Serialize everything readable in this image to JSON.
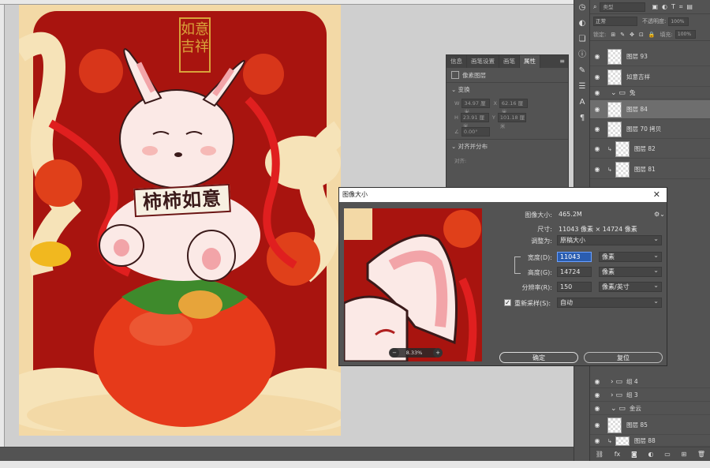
{
  "artwork": {
    "banner_text": "柿柿如意",
    "seal_text": "如意吉祥"
  },
  "properties_panel": {
    "tabs": [
      "信息",
      "画笔设置",
      "画笔",
      "属性"
    ],
    "active_tab": "属性",
    "layer_type": "像素图层",
    "section_transform": "变换",
    "w_label": "W",
    "w_value": "34.97 厘米",
    "x_label": "X",
    "x_value": "62.16 厘米",
    "h_label": "H",
    "h_value": "23.91 厘米",
    "y_label": "Y",
    "y_value": "101.18 厘米",
    "angle_value": "0.00°",
    "section_align": "对齐并分布",
    "align_label": "对齐:"
  },
  "layers_panel": {
    "search_placeholder": "类型",
    "blend_mode": "正常",
    "opacity_label": "不透明度:",
    "opacity_value": "100%",
    "lock_label": "锁定:",
    "fill_label": "填充:",
    "fill_value": "100%",
    "layers": [
      {
        "name": "图层 93",
        "kind": "layer",
        "selected": false
      },
      {
        "name": "如意吉祥",
        "kind": "layer",
        "selected": false
      },
      {
        "name": "兔",
        "kind": "group",
        "selected": false
      },
      {
        "name": "图层 84",
        "kind": "layer",
        "selected": true
      },
      {
        "name": "图层 70 拷贝",
        "kind": "layer",
        "selected": false
      },
      {
        "name": "图层 82",
        "kind": "layer",
        "selected": false
      },
      {
        "name": "图层 81",
        "kind": "layer",
        "selected": false
      },
      {
        "name": "组 4",
        "kind": "group",
        "selected": false
      },
      {
        "name": "组 3",
        "kind": "group",
        "selected": false
      },
      {
        "name": "金云",
        "kind": "group",
        "selected": false
      },
      {
        "name": "图层 85",
        "kind": "layer",
        "selected": false
      },
      {
        "name": "图层 88",
        "kind": "layer",
        "selected": false
      }
    ]
  },
  "image_size_dialog": {
    "title": "图像大小",
    "image_size_label": "图像大小:",
    "image_size_value": "465.2M",
    "dimensions_label": "尺寸:",
    "dimensions_value": "11043 像素 × 14724 像素",
    "fit_to_label": "调整为:",
    "fit_to_value": "原稿大小",
    "width_label": "宽度(D):",
    "width_value": "11043",
    "width_unit": "像素",
    "height_label": "高度(G):",
    "height_value": "14724",
    "height_unit": "像素",
    "resolution_label": "分辨率(R):",
    "resolution_value": "150",
    "resolution_unit": "像素/英寸",
    "resample_label": "重新采样(S):",
    "resample_value": "自动",
    "resample_checked": true,
    "zoom_value": "8.33%",
    "ok_label": "确定",
    "reset_label": "复位"
  }
}
